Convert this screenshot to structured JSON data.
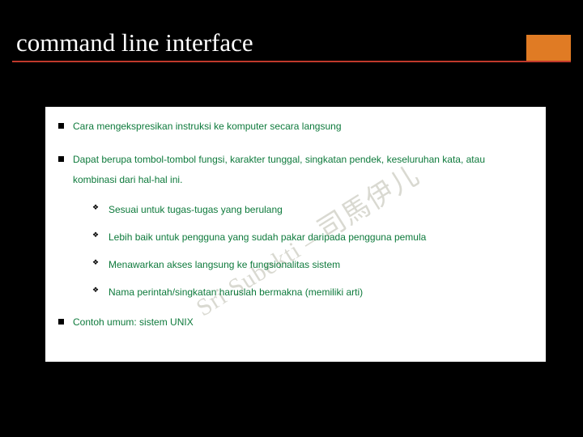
{
  "title": "command line interface",
  "bullets": [
    {
      "text": "Cara mengekspresikan instruksi ke komputer secara langsung"
    },
    {
      "text": "Dapat berupa tombol-tombol fungsi, karakter tunggal, singkatan pendek, keseluruhan kata, atau kombinasi dari hal-hal ini.",
      "sub": [
        "Sesuai untuk tugas-tugas yang berulang",
        "Lebih baik untuk pengguna yang sudah pakar daripada pengguna pemula",
        "Menawarkan akses langsung ke fungsionalitas sistem",
        "Nama perintah/singkatan haruslah bermakna (memiliki arti)"
      ]
    },
    {
      "text": "Contoh umum: sistem UNIX"
    }
  ],
  "watermark": {
    "latin": "Sri Subekti –",
    "cjk": "司馬伊儿"
  },
  "colors": {
    "background": "#000000",
    "accent_box": "#e07b24",
    "rule": "#c0392b",
    "bullet_text": "#0e7a3c"
  }
}
